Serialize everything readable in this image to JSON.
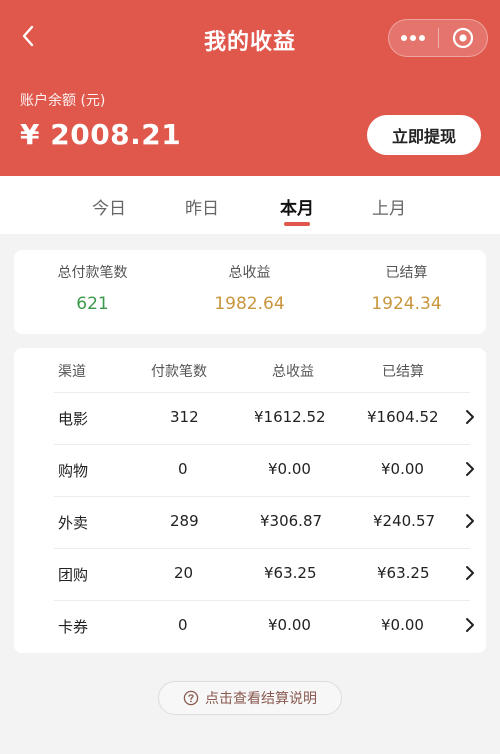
{
  "header": {
    "title": "我的收益",
    "balance_label": "账户余额 (元)",
    "balance_amount": "¥ 2008.21",
    "withdraw_label": "立即提现",
    "icons": {
      "back": "back-arrow-icon",
      "more": "more-dots-icon",
      "close": "target-circle-icon"
    },
    "colors": {
      "background": "#e0574c",
      "text": "#ffffff"
    }
  },
  "tabs": [
    {
      "label": "今日",
      "active": false
    },
    {
      "label": "昨日",
      "active": false
    },
    {
      "label": "本月",
      "active": true
    },
    {
      "label": "上月",
      "active": false
    }
  ],
  "summary": [
    {
      "label": "总付款笔数",
      "value": "621",
      "color": "#3a9a4a"
    },
    {
      "label": "总收益",
      "value": "1982.64",
      "color": "#c8963c"
    },
    {
      "label": "已结算",
      "value": "1924.34",
      "color": "#c8963c"
    }
  ],
  "table": {
    "headers": [
      "渠道",
      "付款笔数",
      "总收益",
      "已结算"
    ],
    "rows": [
      {
        "channel": "电影",
        "count": "312",
        "total": "¥1612.52",
        "settled": "¥1604.52"
      },
      {
        "channel": "购物",
        "count": "0",
        "total": "¥0.00",
        "settled": "¥0.00"
      },
      {
        "channel": "外卖",
        "count": "289",
        "total": "¥306.87",
        "settled": "¥240.57"
      },
      {
        "channel": "团购",
        "count": "20",
        "total": "¥63.25",
        "settled": "¥63.25"
      },
      {
        "channel": "卡券",
        "count": "0",
        "total": "¥0.00",
        "settled": "¥0.00"
      }
    ]
  },
  "help": {
    "label": "点击查看结算说明",
    "icon": "question-circle-icon"
  }
}
